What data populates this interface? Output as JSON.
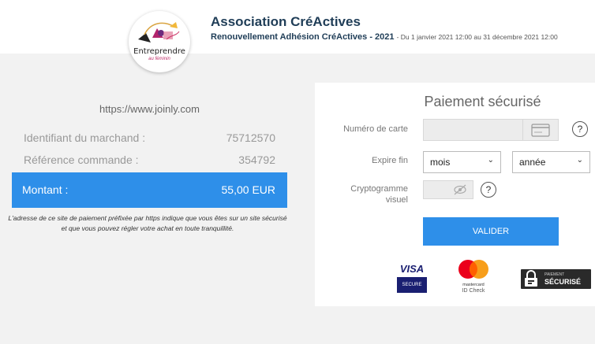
{
  "header": {
    "logo_text": "Entreprendre",
    "logo_subtext": "au féminin",
    "org_name": "Association CréActives",
    "renewal_title": "Renouvellement Adhésion CréActives - 2021",
    "renewal_dates": "- Du 1 janvier 2021 12:00 au 31 décembre 2021 12:00"
  },
  "merchant": {
    "url": "https://www.joinly.com",
    "merchant_id_label": "Identifiant du marchand :",
    "merchant_id_value": "75712570",
    "order_ref_label": "Référence commande :",
    "order_ref_value": "354792",
    "amount_label": "Montant :",
    "amount_value": "55,00 EUR",
    "notice": "L'adresse de ce site de paiement préfixée par https indique que vous êtes sur un site sécurisé et que vous pouvez régler votre achat en toute tranquillité."
  },
  "payment": {
    "title": "Paiement sécurisé",
    "card_number_label": "Numéro de carte",
    "expiry_label": "Expire fin",
    "month_selected": "mois",
    "year_selected": "année",
    "cvv_label_line1": "Cryptogramme",
    "cvv_label_line2": "visuel",
    "help_glyph": "?",
    "validate_label": "VALIDER"
  },
  "badges": {
    "visa_word": "VISA",
    "visa_secure": "SECURE",
    "mastercard_label": "mastercard",
    "mastercard_idcheck": "ID Check",
    "secure_small": "PAIEMENT",
    "secure_big": "SÉCURISÉ"
  },
  "colors": {
    "accent_blue": "#2e8fe9",
    "header_navy": "#1f3d57",
    "panel_bg": "#f2f2f2"
  }
}
